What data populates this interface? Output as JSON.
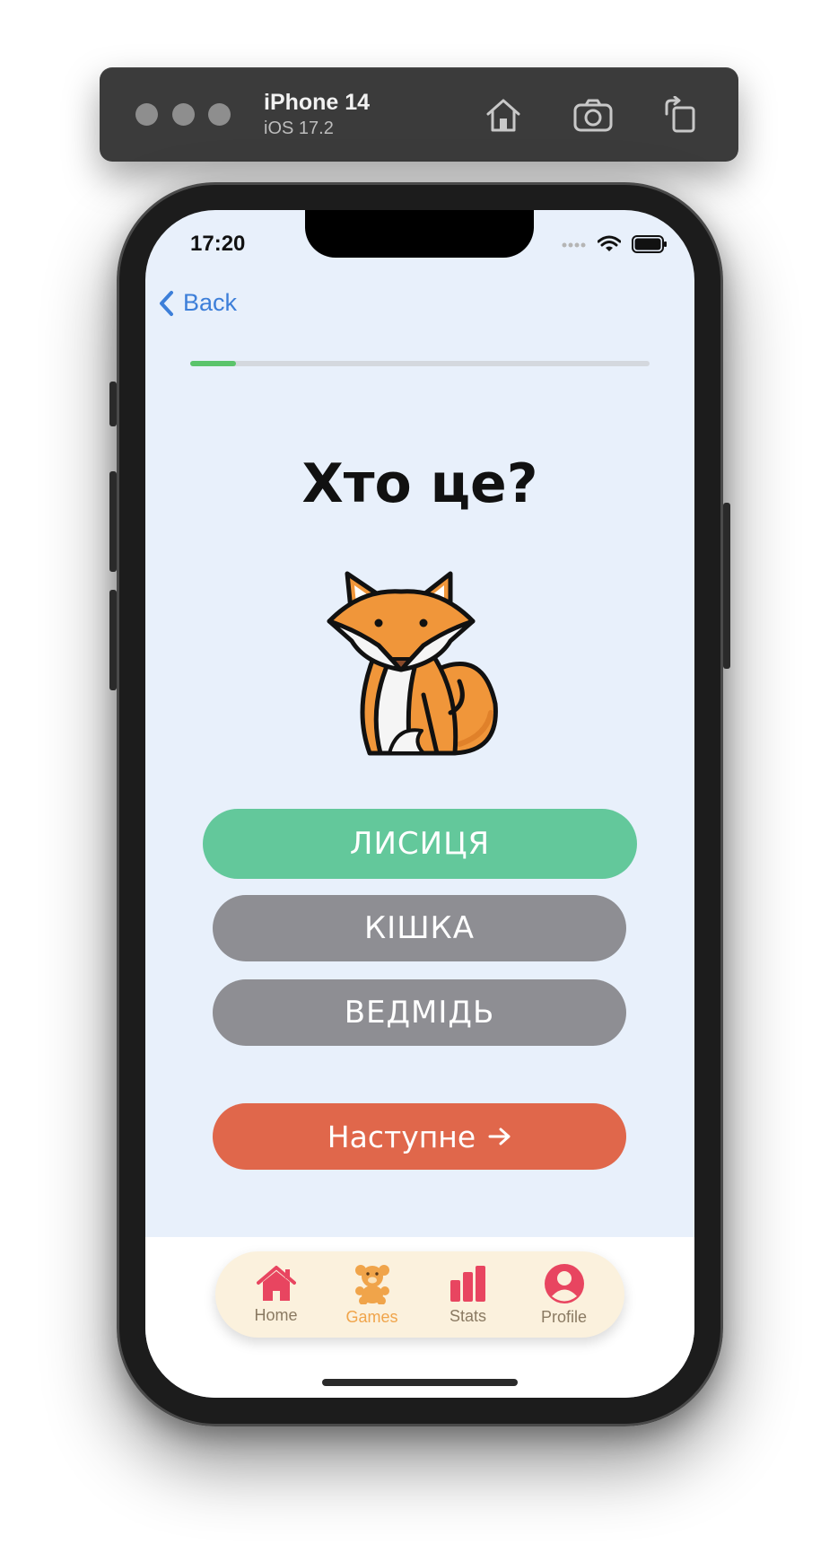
{
  "simulator": {
    "device_name": "iPhone 14",
    "os_version": "iOS 17.2",
    "buttons": [
      "home-icon",
      "screenshot-icon",
      "rotate-icon"
    ]
  },
  "status_bar": {
    "time": "17:20",
    "icons": [
      "signal-icon",
      "wifi-icon",
      "battery-icon"
    ]
  },
  "nav": {
    "back_label": "Back"
  },
  "progress": {
    "fraction": 0.1,
    "color": "#5bc46b"
  },
  "quiz": {
    "question": "Хто це?",
    "image": "fox-illustration",
    "answers": [
      {
        "label": "ЛИСИЦЯ",
        "state": "correct",
        "color": "#63c89b"
      },
      {
        "label": "КІШКА",
        "state": "neutral",
        "color": "#8e8e93"
      },
      {
        "label": "ВЕДМІДЬ",
        "state": "neutral",
        "color": "#8e8e93"
      }
    ],
    "next_label": "Наступне",
    "next_color": "#e0674b"
  },
  "tabs": [
    {
      "label": "Home",
      "icon": "house-icon",
      "active": false
    },
    {
      "label": "Games",
      "icon": "teddy-bear-icon",
      "active": true
    },
    {
      "label": "Stats",
      "icon": "bar-chart-icon",
      "active": false
    },
    {
      "label": "Profile",
      "icon": "person-icon",
      "active": false
    }
  ]
}
